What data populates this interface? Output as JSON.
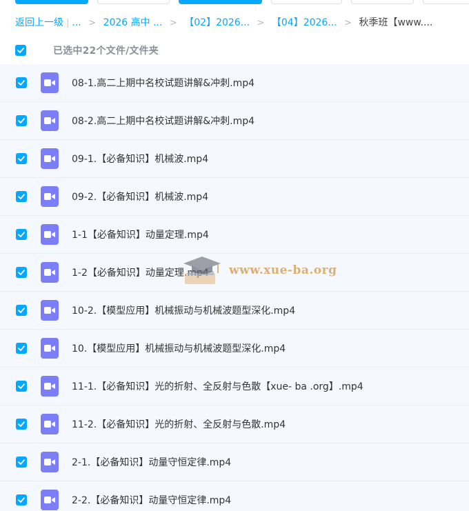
{
  "colors": {
    "accent": "#06a7ff",
    "file_icon": "#7b7ef7",
    "list_bg": "#f5f9ff"
  },
  "breadcrumb": {
    "back": "返回上一级",
    "bar": "|",
    "ellipsis": "...",
    "items": [
      "2026 高中 ...",
      "【02】2026...",
      "【04】2026..."
    ],
    "current": "秋季班【www...."
  },
  "selection": {
    "text": "已选中22个文件/文件夹"
  },
  "files": [
    {
      "name": "08-1.高二上期中名校试题讲解&冲刺.mp4",
      "icon": "video-icon"
    },
    {
      "name": "08-2.高二上期中名校试题讲解&冲刺.mp4",
      "icon": "video-icon"
    },
    {
      "name": "09-1.【必备知识】机械波.mp4",
      "icon": "video-icon"
    },
    {
      "name": "09-2.【必备知识】机械波.mp4",
      "icon": "video-icon"
    },
    {
      "name": "1-1【必备知识】动量定理.mp4",
      "icon": "video-icon"
    },
    {
      "name": "1-2【必备知识】动量定理.mp4",
      "icon": "video-icon"
    },
    {
      "name": "10-2.【模型应用】机械振动与机械波题型深化.mp4",
      "icon": "video-icon"
    },
    {
      "name": "10.【模型应用】机械振动与机械波题型深化.mp4",
      "icon": "video-icon"
    },
    {
      "name": "11-1.【必备知识】光的折射、全反射与色散【xue- ba .org】.mp4",
      "icon": "video-icon"
    },
    {
      "name": "11-2.【必备知识】光的折射、全反射与色散.mp4",
      "icon": "video-icon"
    },
    {
      "name": "2-1.【必备知识】动量守恒定律.mp4",
      "icon": "video-icon"
    },
    {
      "name": "2-2.【必备知识】动量守恒定律.mp4",
      "icon": "video-icon"
    }
  ],
  "watermark": {
    "text": "www.xue-ba.org",
    "icon": "graduation-cap-icon"
  }
}
